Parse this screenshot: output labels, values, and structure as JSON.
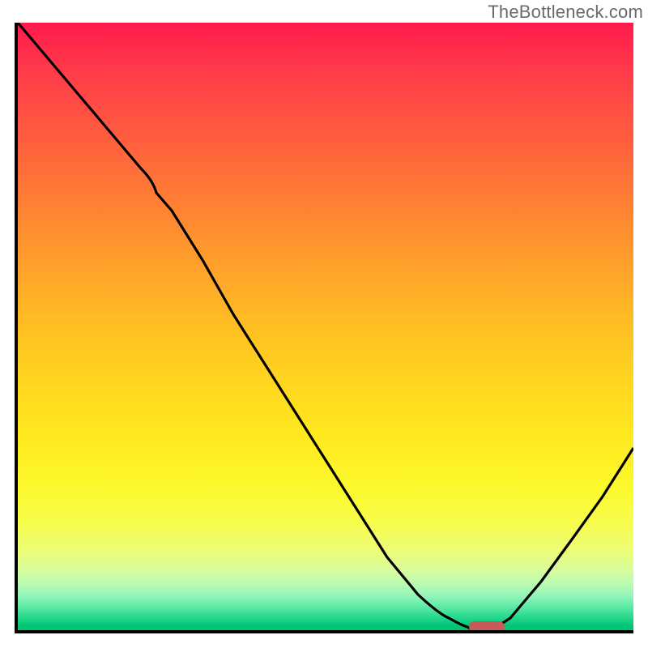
{
  "watermark": "TheBottleneck.com",
  "chart_data": {
    "type": "line",
    "title": "",
    "xlabel": "",
    "ylabel": "",
    "xlim": [
      0,
      100
    ],
    "ylim": [
      0,
      100
    ],
    "grid": false,
    "legend": false,
    "series": [
      {
        "name": "bottleneck-curve",
        "x": [
          0,
          5,
          10,
          15,
          20,
          22,
          25,
          30,
          35,
          40,
          45,
          50,
          55,
          60,
          65,
          70,
          72,
          75,
          77,
          80,
          85,
          90,
          95,
          100
        ],
        "y": [
          100,
          94,
          88,
          82,
          76,
          74,
          69,
          61,
          52,
          44,
          36,
          28,
          20,
          12,
          6,
          2,
          1,
          0,
          0,
          2,
          8,
          15,
          22,
          30
        ]
      }
    ],
    "background_gradient": {
      "type": "vertical",
      "stops": [
        {
          "pos": 0.0,
          "color": "#ff1a4d"
        },
        {
          "pos": 0.5,
          "color": "#ffb924"
        },
        {
          "pos": 0.8,
          "color": "#f8fd4a"
        },
        {
          "pos": 0.95,
          "color": "#5de9a5"
        },
        {
          "pos": 1.0,
          "color": "#00c673"
        }
      ]
    },
    "optimum_marker": {
      "x_start": 74,
      "x_end": 80,
      "y": 0,
      "color": "#c85a5a"
    }
  },
  "colors": {
    "axis": "#000000",
    "line": "#000000",
    "marker": "#c85a5a",
    "watermark": "#6a6a6a"
  }
}
